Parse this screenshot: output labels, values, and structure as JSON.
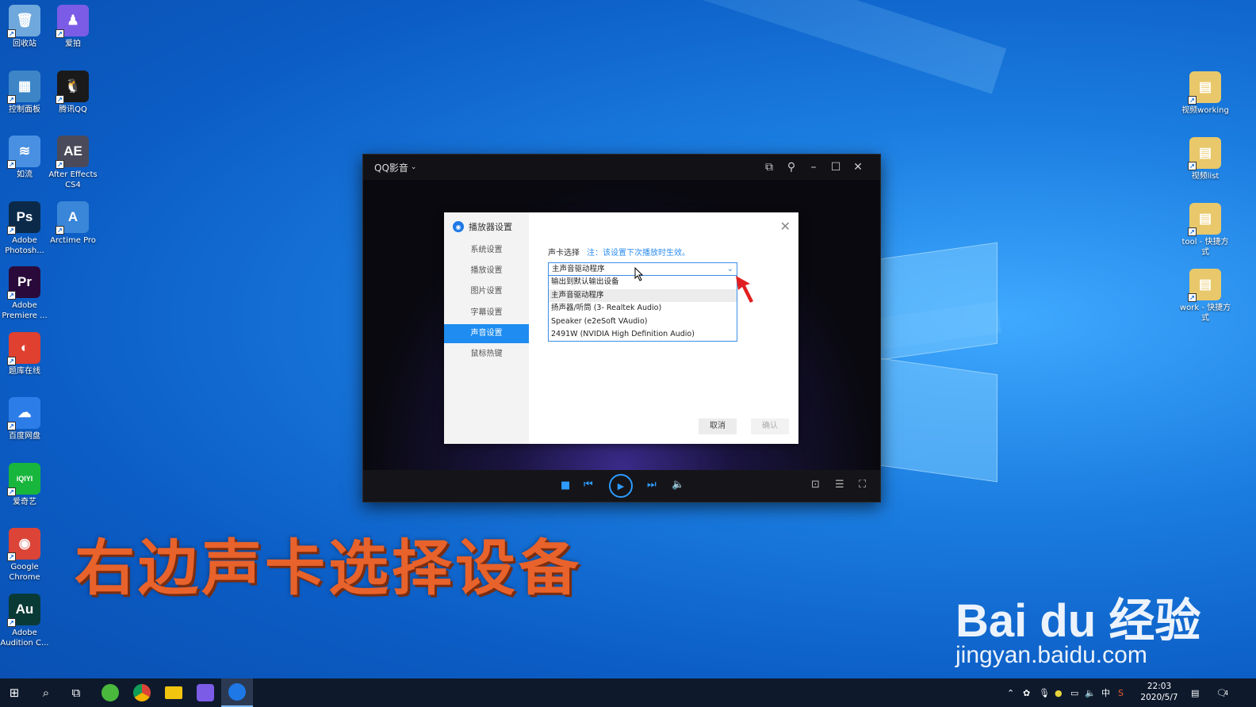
{
  "desktop": {
    "icons_left": [
      {
        "label": "回收站",
        "glyph": "🗑",
        "color": "#6fa8dc"
      },
      {
        "label": "控制面板",
        "glyph": "▦",
        "color": "#3d85c6"
      },
      {
        "label": "如流",
        "glyph": "≋",
        "color": "#4a90e2"
      },
      {
        "label": "Adobe Photosh...",
        "glyph": "Ps",
        "color": "#0b2a4a"
      },
      {
        "label": "Adobe Premiere ...",
        "glyph": "Pr",
        "color": "#2a0a3a"
      },
      {
        "label": "题库在线",
        "glyph": "◐",
        "color": "#e04030"
      },
      {
        "label": "百度网盘",
        "glyph": "☁",
        "color": "#2d7de8"
      },
      {
        "label": "爱奇艺",
        "glyph": "iQIYI",
        "color": "#18b63c"
      },
      {
        "label": "Google Chrome",
        "glyph": "◉",
        "color": "#db4437"
      },
      {
        "label": "Adobe Audition C...",
        "glyph": "Au",
        "color": "#0a3a36"
      }
    ],
    "icons_col2": [
      {
        "label": "爱拍",
        "glyph": "♟",
        "color": "#7b5ce6"
      },
      {
        "label": "腾讯QQ",
        "glyph": "🐧",
        "color": "#1a1a1a"
      },
      {
        "label": "After Effects CS4",
        "glyph": "AE",
        "color": "#4a4a5a"
      },
      {
        "label": "Arctime Pro",
        "glyph": "A",
        "color": "#3a86d8"
      }
    ],
    "icons_right": [
      {
        "label": "视频working",
        "glyph": "▤",
        "color": "#e8c86a"
      },
      {
        "label": "视频list",
        "glyph": "▤",
        "color": "#e8c86a"
      },
      {
        "label": "tool - 快捷方式",
        "glyph": "▤",
        "color": "#e8c86a"
      },
      {
        "label": "work - 快捷方式",
        "glyph": "▤",
        "color": "#e8c86a"
      }
    ]
  },
  "player": {
    "title": "QQ影音",
    "title_icons": [
      "mini-mode-icon",
      "pin-icon",
      "minimize-icon",
      "maximize-icon",
      "close-icon"
    ]
  },
  "dialog": {
    "title": "播放器设置",
    "nav": [
      "系统设置",
      "播放设置",
      "图片设置",
      "字幕设置",
      "声音设置",
      "鼠标热键"
    ],
    "active_nav": "声音设置",
    "sound_card_label": "声卡选择",
    "note": "注：该设置下次播放时生效。",
    "selected": "主声音驱动程序",
    "options": [
      "输出到默认输出设备",
      "主声音驱动程序",
      "扬声器/听筒 (3- Realtek Audio)",
      "Speaker (e2eSoft VAudio)",
      "2491W (NVIDIA High Definition Audio)"
    ],
    "highlighted_option": "主声音驱动程序",
    "cancel_label": "取消",
    "ok_label": "确认"
  },
  "caption": "右边声卡选择设备",
  "watermark": {
    "brand": "Bai du 经验",
    "url": "jingyan.baidu.com"
  },
  "taskbar": {
    "ime": "中",
    "time": "22:03",
    "date": "2020/5/7",
    "notification_count": "4"
  },
  "colors": {
    "accent": "#1e8cf0",
    "player_blue": "#2d9bff",
    "caption": "#e8622b"
  }
}
